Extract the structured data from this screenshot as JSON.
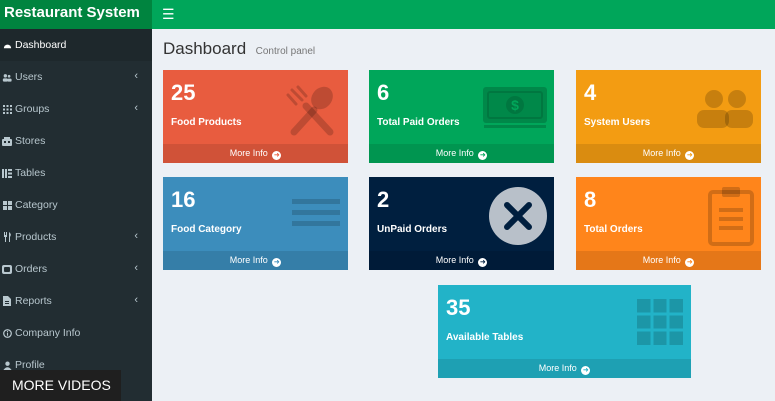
{
  "brand": "Restaurant System",
  "header": {
    "title": "Dashboard",
    "subtitle": "Control panel"
  },
  "sidebar": {
    "items": [
      {
        "label": "Dashboard",
        "icon": "dashboard-icon",
        "expandable": false,
        "active": true
      },
      {
        "label": "Users",
        "icon": "users-icon",
        "expandable": true
      },
      {
        "label": "Groups",
        "icon": "groups-icon",
        "expandable": true
      },
      {
        "label": "Stores",
        "icon": "stores-icon",
        "expandable": false
      },
      {
        "label": "Tables",
        "icon": "tables-icon",
        "expandable": false
      },
      {
        "label": "Category",
        "icon": "category-icon",
        "expandable": false
      },
      {
        "label": "Products",
        "icon": "products-icon",
        "expandable": true
      },
      {
        "label": "Orders",
        "icon": "orders-icon",
        "expandable": true
      },
      {
        "label": "Reports",
        "icon": "reports-icon",
        "expandable": true
      },
      {
        "label": "Company Info",
        "icon": "company-info-icon",
        "expandable": false
      },
      {
        "label": "Profile",
        "icon": "profile-icon",
        "expandable": false
      }
    ]
  },
  "boxes": [
    {
      "value": "25",
      "label": "Food Products",
      "footer": "More Info",
      "color": "#e85c3f",
      "icon": "utensils-icon"
    },
    {
      "value": "6",
      "label": "Total Paid Orders",
      "footer": "More Info",
      "color": "#00a65a",
      "icon": "money-icon"
    },
    {
      "value": "4",
      "label": "System Users",
      "footer": "More Info",
      "color": "#f39c12",
      "icon": "users-icon"
    },
    {
      "value": "16",
      "label": "Food Category",
      "footer": "More Info",
      "color": "#3c8dbc",
      "icon": "list-icon"
    },
    {
      "value": "2",
      "label": "UnPaid Orders",
      "footer": "More Info",
      "color": "#001f3f",
      "icon": "times-circle-icon"
    },
    {
      "value": "8",
      "label": "Total Orders",
      "footer": "More Info",
      "color": "#ff851b",
      "icon": "clipboard-icon"
    },
    {
      "value": "35",
      "label": "Available Tables",
      "footer": "More Info",
      "color": "#22b3c8",
      "icon": "table-grid-icon"
    }
  ],
  "overlay": {
    "more_videos": "MORE VIDEOS"
  }
}
